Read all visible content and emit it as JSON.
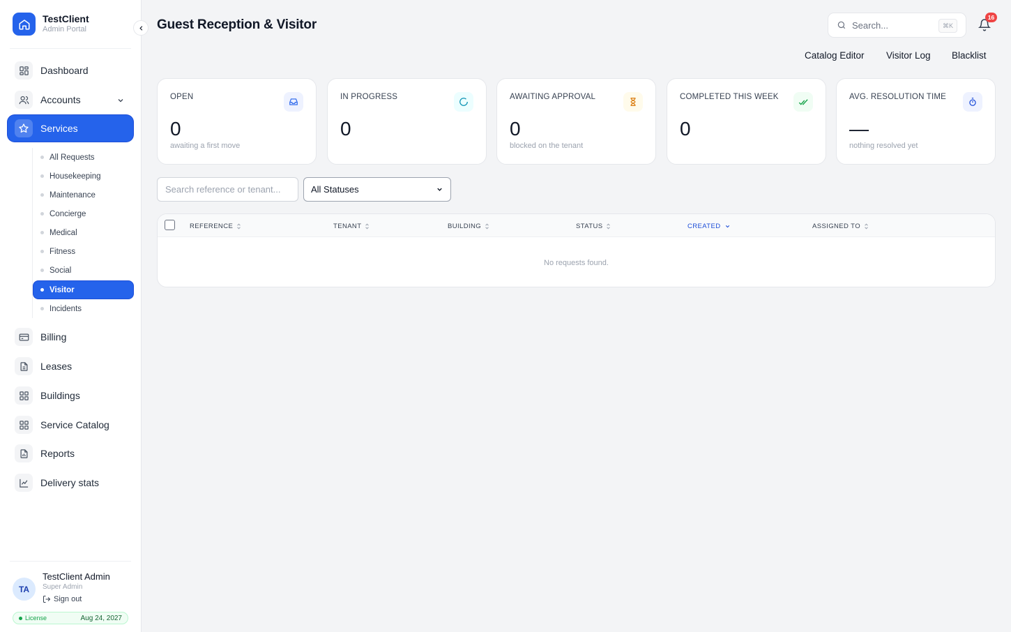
{
  "brand": {
    "name": "TestClient",
    "subtitle": "Admin Portal"
  },
  "nav": {
    "dashboard": "Dashboard",
    "accounts": "Accounts",
    "services": "Services",
    "billing": "Billing",
    "leases": "Leases",
    "buildings": "Buildings",
    "service_catalog": "Service Catalog",
    "reports": "Reports",
    "delivery_stats": "Delivery stats"
  },
  "services_sub": [
    "All Requests",
    "Housekeeping",
    "Maintenance",
    "Concierge",
    "Medical",
    "Fitness",
    "Social",
    "Visitor",
    "Incidents"
  ],
  "user": {
    "initials": "TA",
    "name": "TestClient Admin",
    "role": "Super Admin",
    "signout": "Sign out"
  },
  "license": {
    "label": "License",
    "date": "Aug 24, 2027"
  },
  "header": {
    "title": "Guest Reception & Visitor",
    "search_placeholder": "Search...",
    "search_shortcut": "⌘K",
    "notifications": "16"
  },
  "tabs": {
    "catalog_editor": "Catalog Editor",
    "visitor_log": "Visitor Log",
    "blacklist": "Blacklist"
  },
  "stats": [
    {
      "label": "OPEN",
      "value": "0",
      "sub": "awaiting a first move"
    },
    {
      "label": "IN PROGRESS",
      "value": "0",
      "sub": ""
    },
    {
      "label": "AWAITING APPROVAL",
      "value": "0",
      "sub": "blocked on the tenant"
    },
    {
      "label": "COMPLETED THIS WEEK",
      "value": "0",
      "sub": ""
    },
    {
      "label": "AVG. RESOLUTION TIME",
      "value": "—",
      "sub": "nothing resolved yet"
    }
  ],
  "filters": {
    "search_placeholder": "Search reference or tenant...",
    "status_selected": "All Statuses"
  },
  "table": {
    "columns": [
      "REFERENCE",
      "TENANT",
      "BUILDING",
      "STATUS",
      "CREATED",
      "ASSIGNED TO"
    ],
    "sorted_column": "CREATED",
    "empty_message": "No requests found."
  },
  "colors": {
    "accent": "#2563eb",
    "badge": "#ef4444",
    "license": "#16a34a"
  }
}
